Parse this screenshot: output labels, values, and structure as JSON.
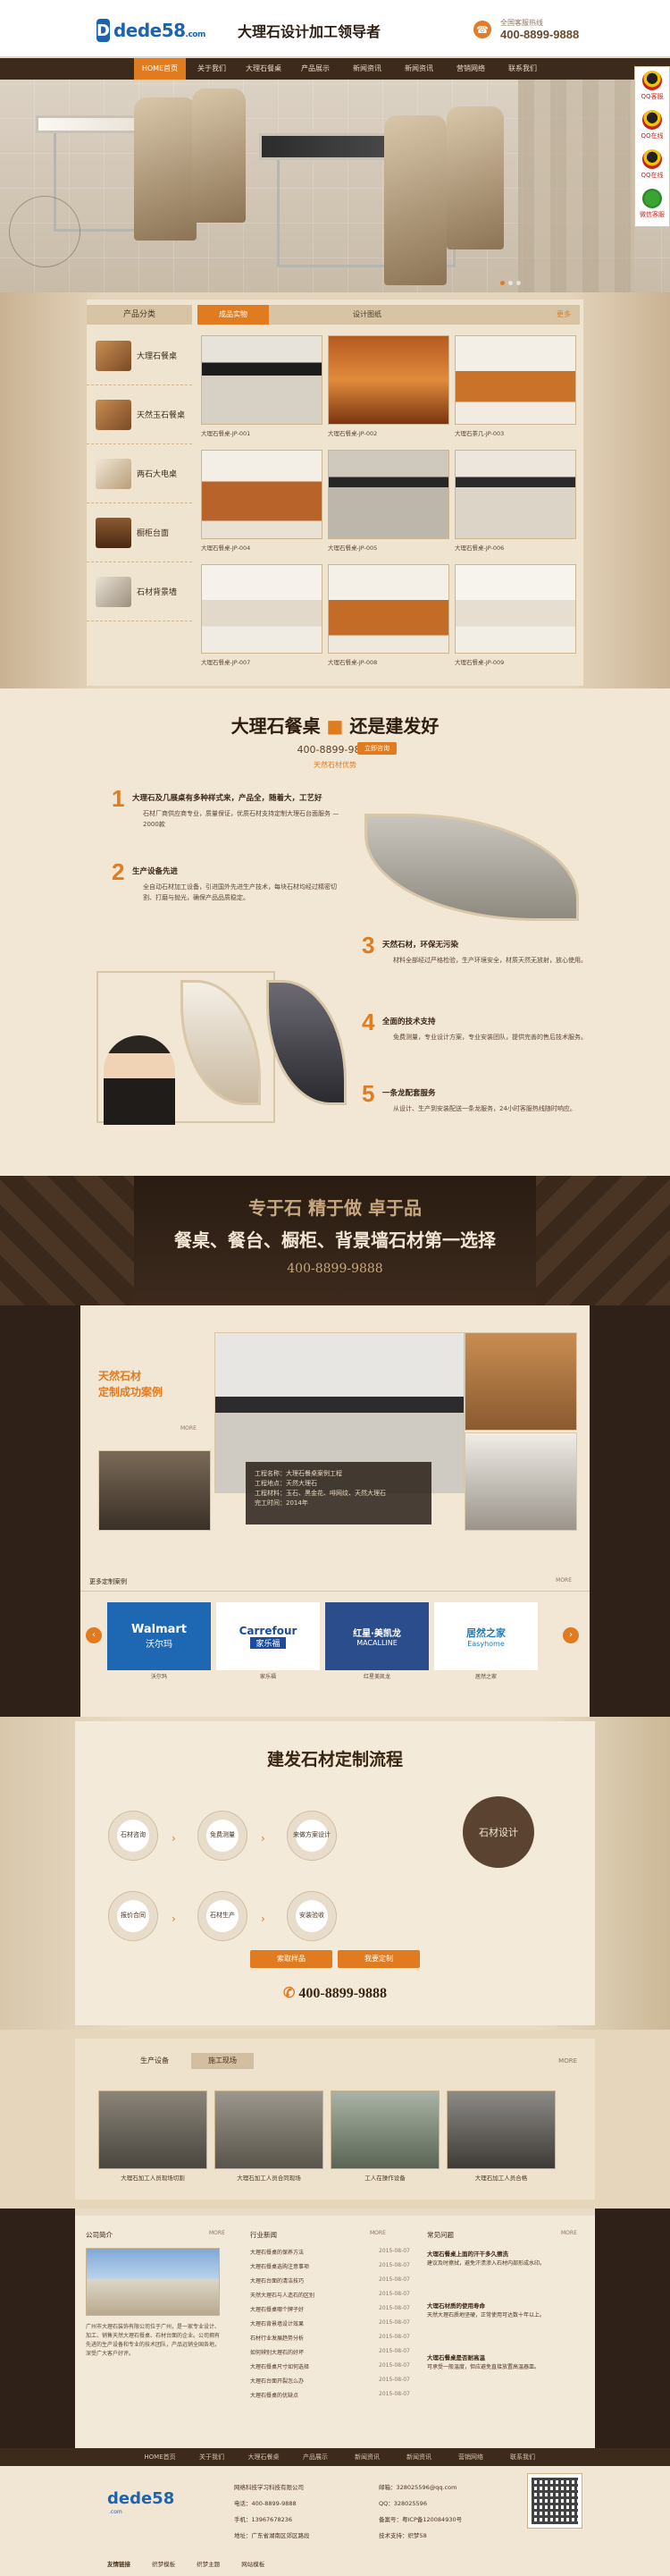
{
  "header": {
    "logo_mark": "D",
    "logo_word": "dede58",
    "logo_domain": ".com",
    "slogan": "大理石设计加工领导者",
    "hotline_label": "全国客服热线",
    "hotline_number": "400-8899-9888",
    "hotline_icon": "phone-icon"
  },
  "nav": {
    "items": [
      "HOME首页",
      "关于我们",
      "大理石餐桌",
      "产品展示",
      "新闻资讯",
      "新闻资讯",
      "营销网络",
      "联系我们"
    ]
  },
  "qq_float": {
    "items": [
      "QQ客服",
      "QQ在线",
      "QQ在线",
      "微信客服"
    ]
  },
  "products": {
    "category_head": "产品分类",
    "categories": [
      "大理石餐桌",
      "天然玉石餐桌",
      "两石大电桌",
      "橱柜台面",
      "石材背景墙"
    ],
    "tabs": [
      "成品实物",
      "设计图纸"
    ],
    "more": "更多",
    "cards": [
      "大理石餐桌-JP-001",
      "大理石餐桌-JP-002",
      "大理石茶几-JP-003",
      "大理石餐桌-JP-004",
      "大理石餐桌-JP-005",
      "大理石餐桌-JP-006",
      "大理石餐桌-JP-007",
      "大理石餐桌-JP-008",
      "大理石餐桌-JP-009"
    ]
  },
  "advantages": {
    "title_a": "大理石餐桌",
    "title_b": "还是建发好",
    "phone": "400-8899-9888",
    "button": "立即咨询",
    "subtitle": "天然石材优势",
    "points": [
      {
        "num": "1",
        "head": "大理石及几展桌有多种样式来，产品全，随着大，工艺好",
        "text": "石材厂商供应商专业，质量保证，优质石材支持定制大理石台面服务 — 2000款"
      },
      {
        "num": "2",
        "head": "生产设备先进",
        "text": "全自动石材加工设备，引进国外先进生产技术，每块石材均经过精密切割、打磨与抛光，确保产品品质稳定。"
      },
      {
        "num": "3",
        "head": "天然石材，环保无污染",
        "text": "材料全部经过严格检验，生产环境安全，材质天然无放射，放心使用。"
      },
      {
        "num": "4",
        "head": "全面的技术支持",
        "text": "免费测量，专业设计方案，专业安装团队，提供完善的售后技术服务。"
      },
      {
        "num": "5",
        "head": "一条龙配套服务",
        "text": "从设计、生产到安装配送一条龙服务，24小时客服热线随时响应。"
      }
    ]
  },
  "band": {
    "line1": "专于石 精于做 卓于品",
    "line2": "餐桌、餐台、橱柜、背景墙石材第一选择",
    "phone": "400-8899-9888"
  },
  "cases": {
    "title_1": "天然石材",
    "title_2": "定制成功案例",
    "more": "MORE",
    "info": [
      "工程名称：大理石餐桌案例工程",
      "工程地点：天然大理石",
      "工程材料：玉石、黑金花、啡网纹、天然大理石",
      "完工时间：2014年"
    ],
    "partners_head": "更多定制案例",
    "partners_more": "MORE",
    "partners": [
      {
        "logo_a": "Walmart",
        "logo_b": "沃尔玛",
        "name": "沃尔玛"
      },
      {
        "logo_a": "Carrefour",
        "logo_b": "家乐福",
        "name": "家乐福"
      },
      {
        "logo_a": "红星·美凯龙",
        "logo_b": "MACALLINE",
        "name": "红星美凯龙"
      },
      {
        "logo_a": "居然之家",
        "logo_b": "Easyhome",
        "name": "居然之家"
      }
    ],
    "prev_icon": "chevron-left-icon",
    "next_icon": "chevron-right-icon"
  },
  "process": {
    "title": "建发石材定制流程",
    "steps": [
      "石材咨询",
      "免费测量",
      "来做方案设计",
      "报价合同",
      "石材生产",
      "安装验收"
    ],
    "big": "石材设计",
    "btn_a": "索取样品",
    "btn_b": "我要定制",
    "phone": "400-8899-9888"
  },
  "equipment": {
    "tabs": [
      "生产设备",
      "施工现场"
    ],
    "more": "MORE",
    "captions": [
      "大理石加工人员现场切割",
      "大理石加工人员合同现场",
      "工人在操作设备",
      "大理石加工人员合格"
    ]
  },
  "news": {
    "about_head": "公司简介",
    "about_more": "MORE",
    "about_text": "广州市大理石装饰有限公司位于广州，是一家专业设计、加工、销售天然大理石餐桌、石材台面的企业。公司拥有先进的生产设备和专业的技术团队，产品远销全国各地，深受广大客户好评。",
    "news_head": "行业新闻",
    "news_more": "MORE",
    "rows": [
      [
        "大理石餐桌的保养方法",
        "2015-08-07"
      ],
      [
        "大理石餐桌选购注意事项",
        "2015-08-07"
      ],
      [
        "大理石台面的清洁技巧",
        "2015-08-07"
      ],
      [
        "天然大理石与人造石的区别",
        "2015-08-07"
      ],
      [
        "大理石餐桌哪个牌子好",
        "2015-08-07"
      ],
      [
        "大理石背景墙设计效果",
        "2015-08-07"
      ],
      [
        "石材行业发展趋势分析",
        "2015-08-07"
      ],
      [
        "如何辨别大理石的好坏",
        "2015-08-07"
      ],
      [
        "大理石餐桌尺寸如何选择",
        "2015-08-07"
      ],
      [
        "大理石台面开裂怎么办",
        "2015-08-07"
      ],
      [
        "大理石餐桌的优缺点",
        "2015-08-07"
      ]
    ],
    "faq_head": "常见问题",
    "faq_more": "MORE",
    "faqs": [
      {
        "q": "大理石餐桌上面的汗干多久擦洗",
        "a": "建议及时擦拭，避免汗渍渗入石材内部形成水印。"
      },
      {
        "q": "大理石材质的使用寿命",
        "a": "天然大理石质地坚硬，正常使用可达数十年以上。"
      },
      {
        "q": "大理石餐桌是否耐高温",
        "a": "可承受一般温度，但应避免直接放置高温器皿。"
      }
    ]
  },
  "footer": {
    "nav": [
      "HOME首页",
      "关于我们",
      "大理石餐桌",
      "产品展示",
      "新闻资讯",
      "新闻资讯",
      "营销网络",
      "联系我们"
    ],
    "logo": "dede58",
    "logo_sub": ".com",
    "company": "网络科技学习科技有限公司",
    "phone": "电话：400-8899-9888",
    "mobile": "手机：13967678236",
    "address": "地址：广东省湖南区郊区路段",
    "email": "邮箱：328025596@qq.com",
    "qq": "QQ：328025596",
    "icp": "备案号：粤ICP备120084930号",
    "tech": "技术支持：织梦58",
    "links_head": "友情链接",
    "links": [
      "织梦模板",
      "织梦主题",
      "网站模板"
    ]
  }
}
